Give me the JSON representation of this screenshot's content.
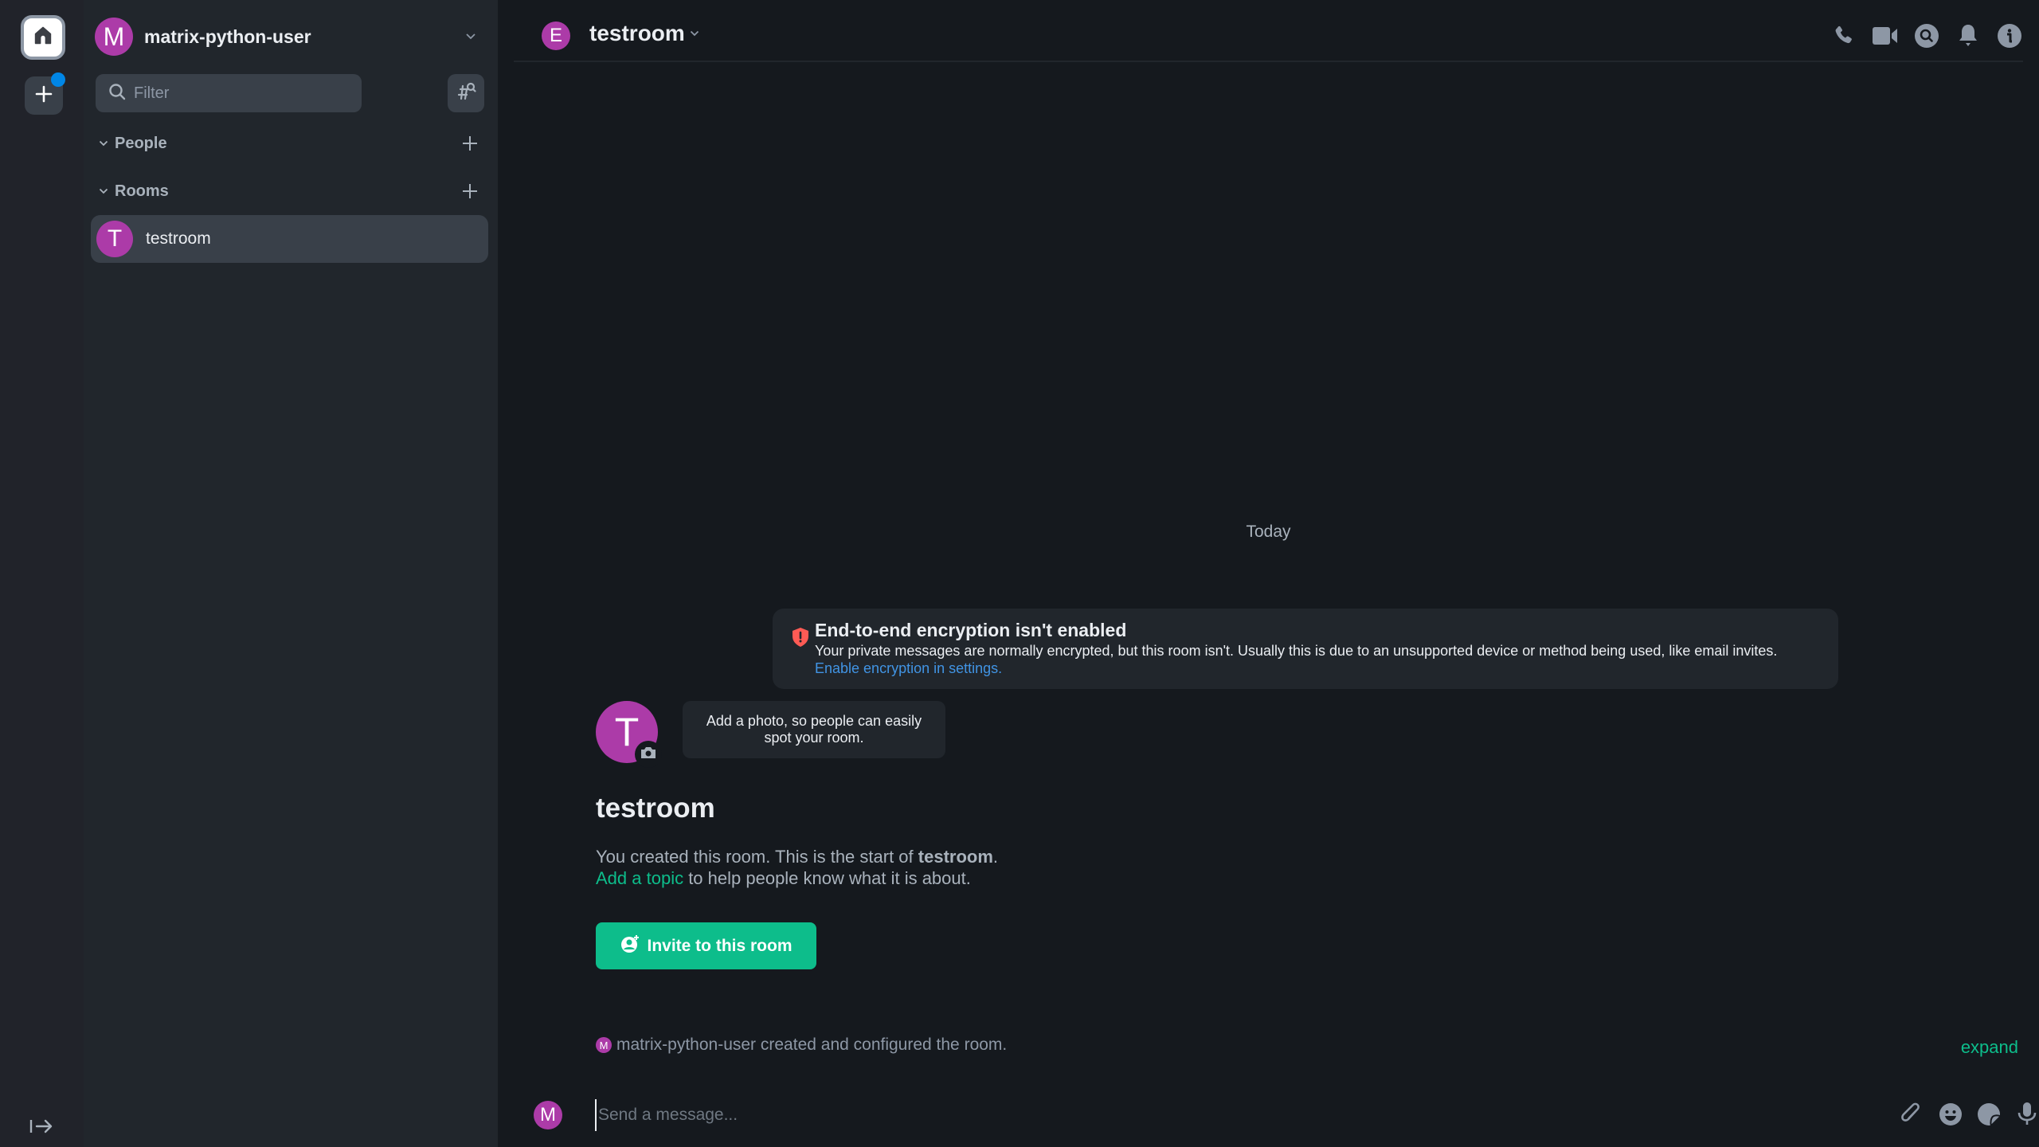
{
  "spacebar": {
    "home_icon": "home-icon",
    "add_space_icon": "plus-icon",
    "add_space_has_notification": true,
    "expand_icon": "expand-sidebar-icon"
  },
  "user_menu": {
    "avatar_letter": "M",
    "username": "matrix-python-user"
  },
  "filter": {
    "placeholder": "Filter",
    "value": ""
  },
  "sections": [
    {
      "label": "People"
    },
    {
      "label": "Rooms"
    }
  ],
  "rooms": [
    {
      "avatar_letter": "T",
      "name": "testroom",
      "selected": true
    }
  ],
  "room_header": {
    "avatar_letter": "E",
    "title": "testroom",
    "icons": [
      "phone-icon",
      "video-call-icon",
      "search-icon",
      "bell-icon",
      "info-icon"
    ]
  },
  "timeline": {
    "date_separator": "Today",
    "encryption_notice": {
      "title": "End-to-end encryption isn't enabled",
      "description": "Your private messages are normally encrypted, but this room isn't. Usually this is due to an unsupported device or method being used, like email invites.",
      "link_text": "Enable encryption in settings."
    },
    "room_intro": {
      "avatar_letter": "T",
      "photo_tooltip": "Add a photo, so people can easily spot your room.",
      "title": "testroom",
      "text_prefix": "You created this room. This is the start of ",
      "text_room": "testroom",
      "text_suffix": ".",
      "topic_link": "Add a topic",
      "topic_suffix": " to help people know what it is about.",
      "invite_button": "Invite to this room"
    },
    "event_summary": {
      "avatar_letter": "M",
      "text": "matrix-python-user created and configured the room.",
      "expand_label": "expand"
    }
  },
  "composer": {
    "avatar_letter": "M",
    "placeholder": "Send a message...",
    "value": "",
    "icons": [
      "attachment-icon",
      "emoji-icon",
      "sticker-icon",
      "microphone-icon"
    ]
  },
  "colors": {
    "accent": "#0dbd8b",
    "avatar": "#ac3ba8",
    "link": "#4194e4",
    "warning": "#ff5b55",
    "notification": "#0086e6"
  }
}
